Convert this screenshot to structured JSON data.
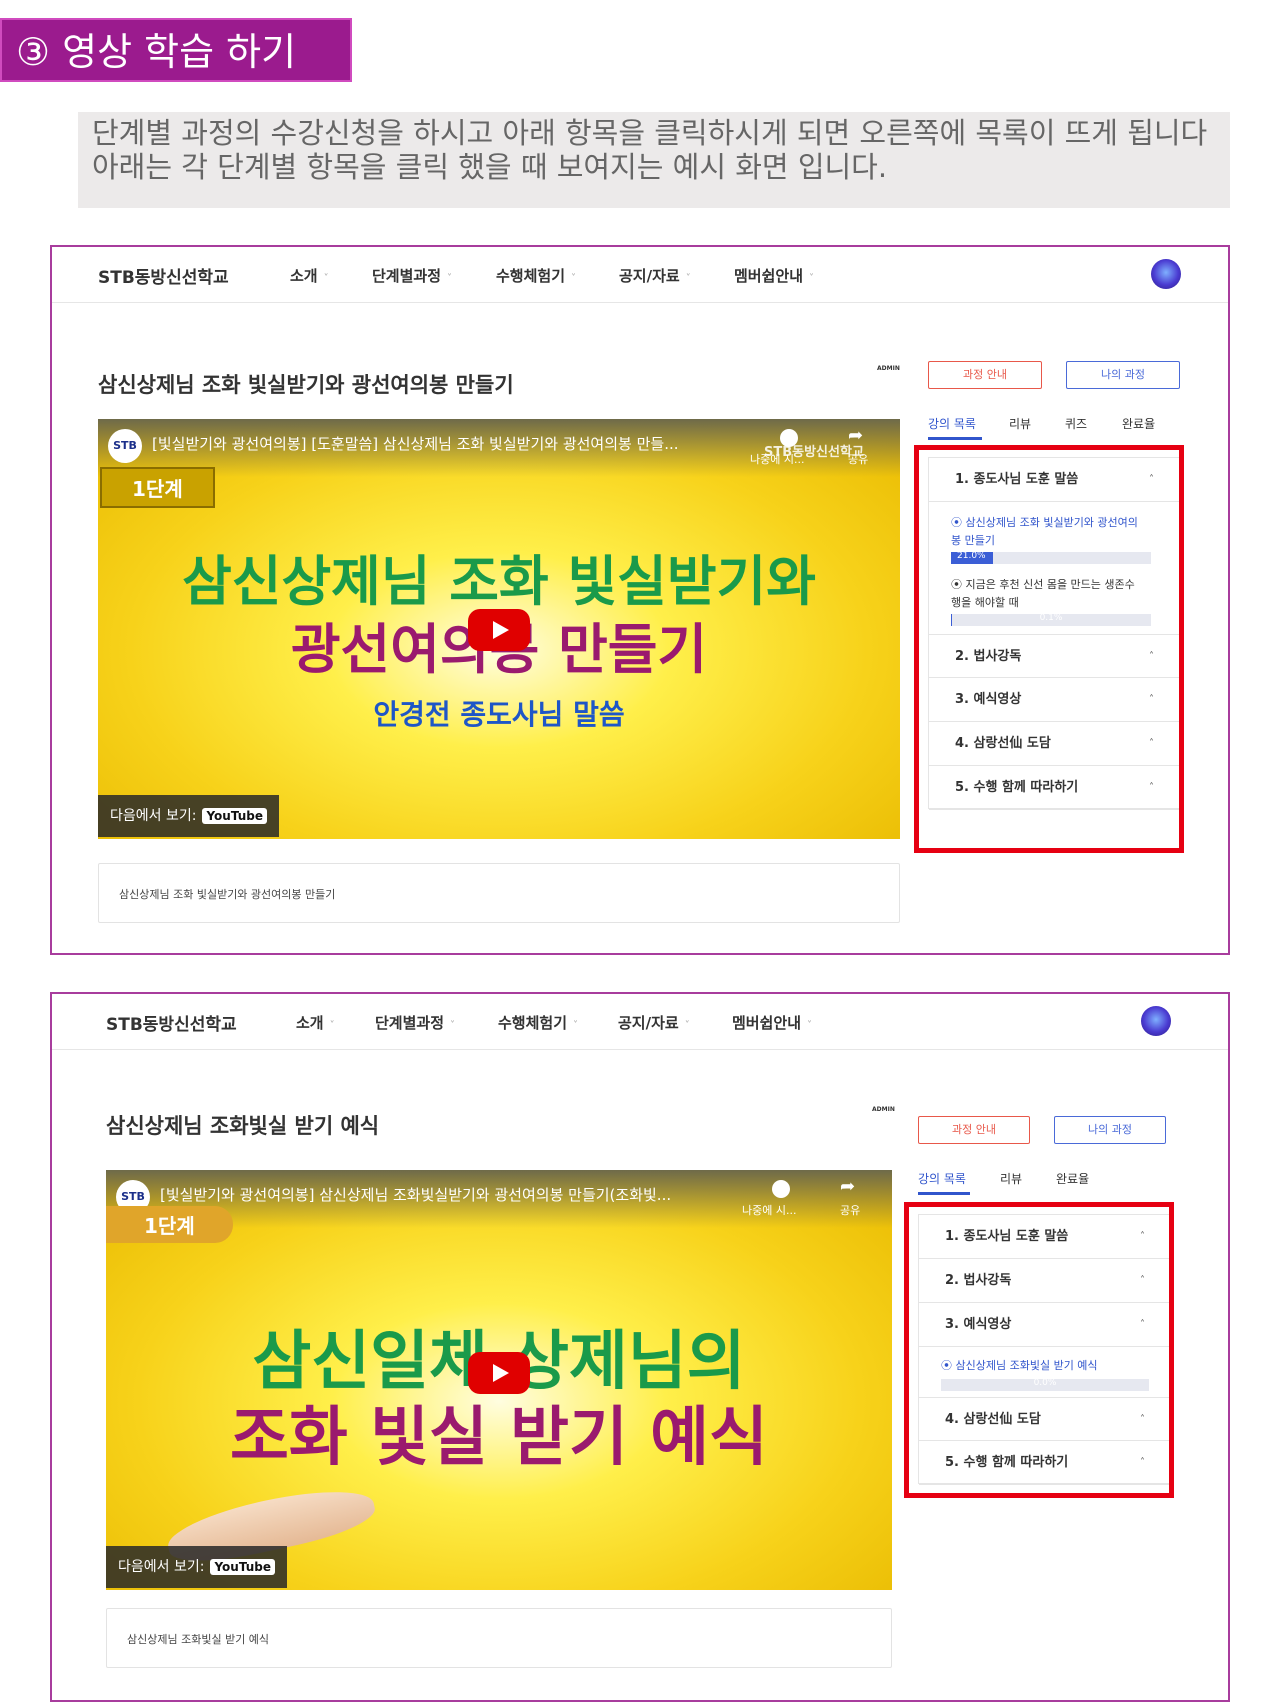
{
  "banner": {
    "title": "③ 영상 학습 하기"
  },
  "info": {
    "line1": "단계별 과정의 수강신청을 하시고 아래 항목을 클릭하시게 되면 오른쪽에 목록이 뜨게 됩니다",
    "line2": "아래는 각 단계별 항목을 클릭 했을 때 보여지는 예시 화면 입니다."
  },
  "nav": {
    "brand": "STB동방신선학교",
    "items": [
      "소개",
      "단계별과정",
      "수행체험기",
      "공지/자료",
      "멤버쉽안내"
    ],
    "chevron": "˅"
  },
  "common": {
    "admin_tag": "ADMIN",
    "course_info_button": "과정 안내",
    "my_course_button": "나의 과정",
    "watch_on": "다음에서 보기:",
    "youtube": "YouTube",
    "watch_later": "나중에 시...",
    "share": "공유",
    "stb_logo": "STB",
    "caret": "˄"
  },
  "panel1": {
    "course_title": "삼신상제님 조화 빛실받기와 광선여의봉 만들기",
    "video": {
      "caption": "[빛실받기와 광선여의봉] [도훈말씀] 삼신상제님 조화 빛실받기와 광선여의봉 만들...",
      "watermark": "STB동방신선학교",
      "stage": "1단계",
      "line1": "삼신상제님 조화 빛실받기와",
      "line2": "광선여의봉 만들기",
      "line3": "안경전 종도사님 말씀"
    },
    "description": "삼신상제님 조화 빛실받기와 광선여의봉 만들기",
    "tabs": [
      "강의 목록",
      "리뷰",
      "퀴즈",
      "완료율"
    ],
    "sections": [
      "1. 종도사님 도훈 말씀",
      "2. 법사강독",
      "3. 예식영상",
      "4. 삼랑선仙 도담",
      "5. 수행 함께 따라하기"
    ],
    "lectures": [
      {
        "line1": "⦿ 삼신상제님 조화 빛실받기와 광선여의",
        "line2": "봉 만들기",
        "progress_label": "21.0%",
        "progress": 0.21
      },
      {
        "line1": "⦿ 지금은 후천 신선 몸을 만드는 생존수",
        "line2": "행을 해야할 때",
        "progress_label": "0.1%",
        "progress": 0.001
      }
    ]
  },
  "panel2": {
    "course_title": "삼신상제님 조화빛실 받기 예식",
    "video": {
      "caption": "[빛실받기와 광선여의봉] 삼신상제님 조화빛실받기와 광선여의봉 만들기(조화빛...",
      "stage": "1단계",
      "line1": "삼신일체 상제님의",
      "line2": "조화 빛실 받기 예식"
    },
    "description": "삼신상제님 조화빛실 받기 예식",
    "tabs": [
      "강의 목록",
      "리뷰",
      "완료율"
    ],
    "sections": [
      "1. 종도사님 도훈 말씀",
      "2. 법사강독",
      "3. 예식영상",
      "4. 삼랑선仙 도담",
      "5. 수행 함께 따라하기"
    ],
    "lectures": [
      {
        "line1": "⦿ 삼신상제님 조화빛실 받기 예식",
        "progress_label": "0.0%",
        "progress": 0.0
      }
    ]
  }
}
